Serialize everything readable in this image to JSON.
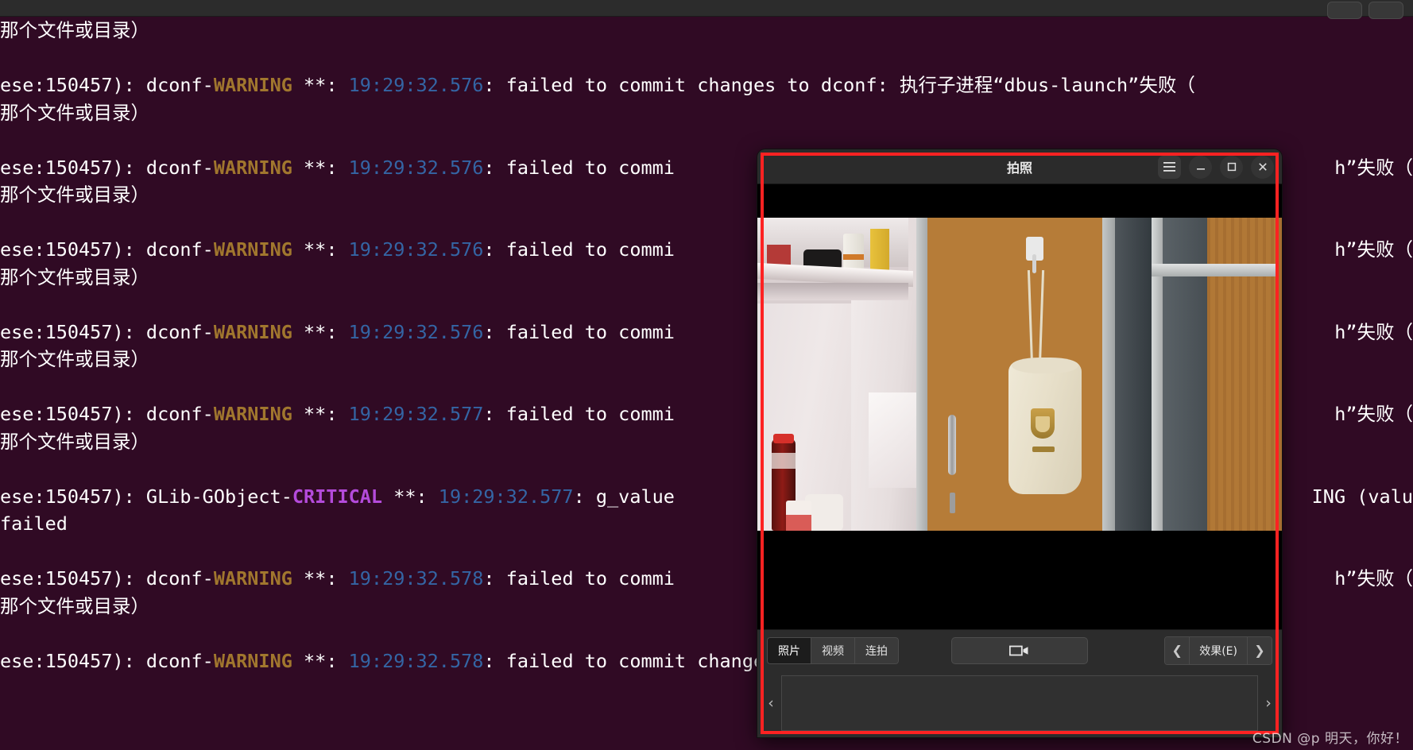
{
  "terminal": {
    "title": "",
    "background_color": "#300a24",
    "warning_color": "#a1772e",
    "critical_color": "#b44bdb",
    "time_color": "#3465a4",
    "titlebar_buttons": [
      "",
      ""
    ],
    "lines": [
      {
        "type": "cn",
        "text": "那个文件或目录）"
      },
      {
        "type": "blank",
        "text": ""
      },
      {
        "type": "log",
        "prefix": "ese:150457): dconf-",
        "level": "WARNING",
        "mid": " **: ",
        "time": "19:29:32.576",
        "suffix": ": failed to commit changes to dconf: 执行子进程“dbus-launch”失败（"
      },
      {
        "type": "cn",
        "text": "那个文件或目录）"
      },
      {
        "type": "blank",
        "text": ""
      },
      {
        "type": "log",
        "prefix": "ese:150457): dconf-",
        "level": "WARNING",
        "mid": " **: ",
        "time": "19:29:32.576",
        "suffix": ": failed to commi",
        "tail": "h”失败（"
      },
      {
        "type": "cn",
        "text": "那个文件或目录）"
      },
      {
        "type": "blank",
        "text": ""
      },
      {
        "type": "log",
        "prefix": "ese:150457): dconf-",
        "level": "WARNING",
        "mid": " **: ",
        "time": "19:29:32.576",
        "suffix": ": failed to commi",
        "tail": "h”失败（"
      },
      {
        "type": "cn",
        "text": "那个文件或目录）"
      },
      {
        "type": "blank",
        "text": ""
      },
      {
        "type": "log",
        "prefix": "ese:150457): dconf-",
        "level": "WARNING",
        "mid": " **: ",
        "time": "19:29:32.576",
        "suffix": ": failed to commi",
        "tail": "h”失败（"
      },
      {
        "type": "cn",
        "text": "那个文件或目录）"
      },
      {
        "type": "blank",
        "text": ""
      },
      {
        "type": "log",
        "prefix": "ese:150457): dconf-",
        "level": "WARNING",
        "mid": " **: ",
        "time": "19:29:32.577",
        "suffix": ": failed to commi",
        "tail": "h”失败（"
      },
      {
        "type": "cn",
        "text": "那个文件或目录）"
      },
      {
        "type": "blank",
        "text": ""
      },
      {
        "type": "log",
        "prefix": "ese:150457): GLib-GObject-",
        "level": "CRITICAL",
        "levelkind": "crit",
        "mid": " **: ",
        "time": "19:29:32.577",
        "suffix": ": g_value",
        "tail": "ING (valu"
      },
      {
        "type": "cn",
        "text": "failed"
      },
      {
        "type": "blank",
        "text": ""
      },
      {
        "type": "log",
        "prefix": "ese:150457): dconf-",
        "level": "WARNING",
        "mid": " **: ",
        "time": "19:29:32.578",
        "suffix": ": failed to commi",
        "tail": "h”失败（"
      },
      {
        "type": "cn",
        "text": "那个文件或目录）"
      },
      {
        "type": "blank",
        "text": ""
      },
      {
        "type": "log",
        "prefix": "ese:150457): dconf-",
        "level": "WARNING",
        "mid": " **: ",
        "time": "19:29:32.578",
        "suffix": ": failed to commit changes to dconf: 执行子进程“dbus-launch”失败（"
      }
    ]
  },
  "cheese": {
    "title": "拍照",
    "titlebar": {
      "menu_icon": "hamburger-menu-icon",
      "minimize_icon": "minimize-icon",
      "maximize_icon": "maximize-icon",
      "close_icon": "close-icon",
      "menu_glyph": "☰",
      "minimize_glyph": "—",
      "maximize_glyph": "▫",
      "close_glyph": "✕"
    },
    "modes": [
      {
        "label": "照片",
        "active": true
      },
      {
        "label": "视频",
        "active": false
      },
      {
        "label": "连拍",
        "active": false
      }
    ],
    "shoot": {
      "icon": "camera-video-icon",
      "glyph": "▭▶"
    },
    "effects": {
      "prev_glyph": "❮",
      "label": "效果(E)",
      "next_glyph": "❯"
    },
    "gallery": {
      "prev_glyph": "‹",
      "next_glyph": "›",
      "items": []
    },
    "preview": {
      "description": "webcam live preview: room interior with white shelf, wooden door, cream drawstring bag with AFA crest hanging on a hook, cola bottle, wardrobe"
    }
  },
  "annotation": {
    "border_color": "#fd2222"
  },
  "watermark": {
    "text": "CSDN @p 明天，你好！"
  }
}
